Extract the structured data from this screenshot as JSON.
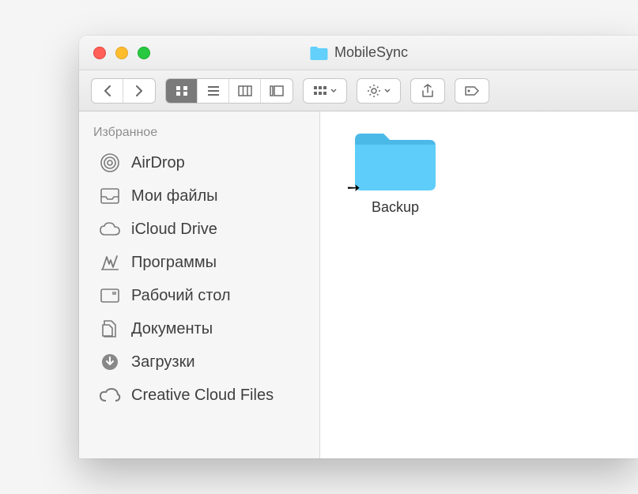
{
  "window": {
    "title": "MobileSync"
  },
  "sidebar": {
    "section_title": "Избранное",
    "items": [
      {
        "label": "AirDrop"
      },
      {
        "label": "Мои файлы"
      },
      {
        "label": "iCloud Drive"
      },
      {
        "label": "Программы"
      },
      {
        "label": "Рабочий стол"
      },
      {
        "label": "Документы"
      },
      {
        "label": "Загрузки"
      },
      {
        "label": "Creative Cloud Files"
      }
    ]
  },
  "content": {
    "items": [
      {
        "name": "Backup"
      }
    ]
  }
}
